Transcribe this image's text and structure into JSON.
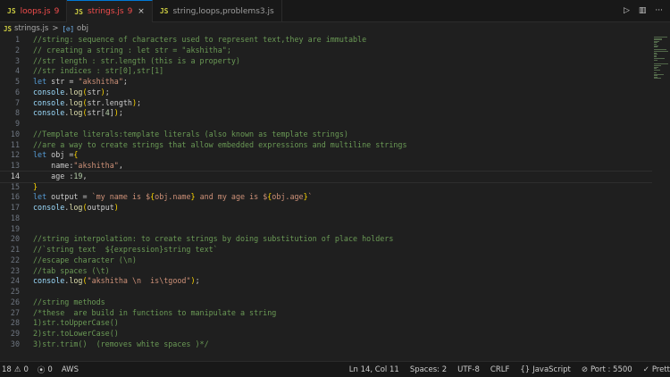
{
  "tabs": [
    {
      "badge": "JS",
      "name": "loops.js",
      "count": "9",
      "active": false
    },
    {
      "badge": "JS",
      "name": "strings.js",
      "count": "9",
      "active": true
    },
    {
      "badge": "JS",
      "name": "string,loops,problems3.js",
      "count": "",
      "active": false
    }
  ],
  "tab_close": "×",
  "tab_actions": {
    "run": "▷",
    "split": "▥",
    "more": "···"
  },
  "breadcrumb": {
    "badge": "JS",
    "file": "strings.js",
    "separator": ">",
    "symbol_icon": "[⊘]",
    "symbol": "obj"
  },
  "code_lines": [
    "//string: sequence of characters used to represent text,they are immutable",
    "// creating a string : let str = \"akshitha\";",
    "//str length : str.length (this is a property)",
    "//str indices : str[0],str[1]",
    "let str = \"akshitha\";",
    "console.log(str);",
    "console.log(str.length);",
    "console.log(str[4]);",
    "",
    "//Template literals:template literals (also known as template strings)",
    "//are a way to create strings that allow embedded expressions and multiline strings",
    "let obj ={",
    "    name:\"akshitha\",",
    "    age :19,",
    "}",
    "let output = `my name is ${obj.name} and my age is ${obj.age}`",
    "console.log(output)",
    "",
    "",
    "//string interpolation: to create strings by doing substitution of place holders",
    "//`string text  ${expression}string text`",
    "//escape character (\\n)",
    "//tab spaces (\\t)",
    "console.log(\"akshitha \\n  is\\tgood\");",
    "",
    "//string methods",
    "/*these  are build in functions to manipulate a string",
    "1)str.toUpperCase()",
    "2)str.toLowerCase()",
    "3)str.trim()  (removes white spaces )*/"
  ],
  "line_numbers": [
    "1",
    "2",
    "3",
    "4",
    "5",
    "6",
    "7",
    "8",
    "9",
    "10",
    "11",
    "12",
    "13",
    "14",
    "15",
    "16",
    "17",
    "18",
    "19",
    "20",
    "21",
    "22",
    "23",
    "24",
    "25",
    "26",
    "27",
    "28",
    "29",
    "30"
  ],
  "current_line": 14,
  "status": {
    "errors": "18",
    "warnings": "0",
    "ports_forwarded": "0",
    "aws": "AWS",
    "position": "Ln 14, Col 11",
    "spaces": "Spaces: 2",
    "encoding": "UTF-8",
    "eol": "CRLF",
    "language": "JavaScript",
    "port": "Port : 5500",
    "prettier": "Prett"
  },
  "colors": {
    "accent": "#0078d4",
    "error": "#f14c4c",
    "js_badge": "#cbcb41"
  }
}
